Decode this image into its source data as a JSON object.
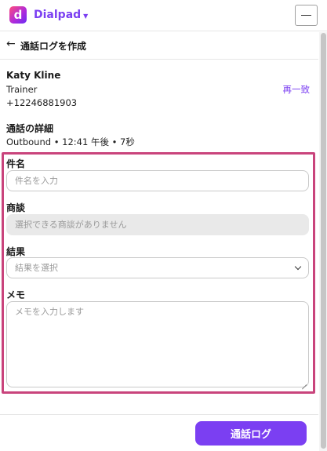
{
  "app": {
    "brand_initial": "d",
    "brand_name": "Dialpad"
  },
  "header": {
    "title": "通話ログを作成"
  },
  "contact": {
    "name": "Katy Kline",
    "role": "Trainer",
    "phone": "+12246881903",
    "rematch_label": "再一致"
  },
  "details": {
    "title": "通話の詳細",
    "summary": "Outbound • 12:41 午後 • 7秒"
  },
  "form": {
    "subject_label": "件名",
    "subject_placeholder": "件名を入力",
    "deal_label": "商談",
    "deal_placeholder": "選択できる商談がありません",
    "result_label": "結果",
    "result_value": "結果を選択",
    "memo_label": "メモ",
    "memo_placeholder": "メモを入力します"
  },
  "footer": {
    "submit_label": "通話ログ"
  },
  "colors": {
    "accent": "#7b3ff2",
    "highlight_border": "#c9447c"
  }
}
